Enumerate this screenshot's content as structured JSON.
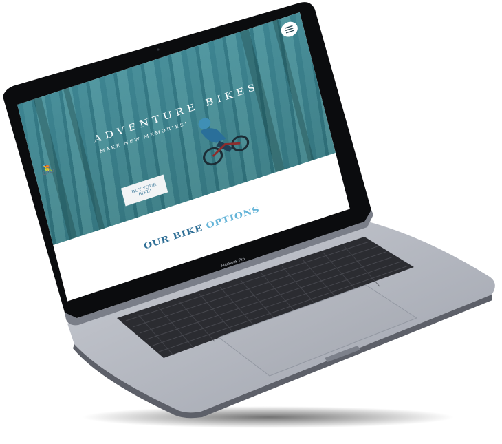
{
  "site": {
    "hero_title": "ADVENTURE BIKES",
    "hero_subtitle": "MAKE NEW MEMORIES!",
    "cta_label": "BUY YOUR BIKE!",
    "section_title_part1": "OUR BIKE",
    "section_title_part2": " OPTIONS"
  },
  "device": {
    "model_label": "MacBook Pro"
  },
  "colors": {
    "accent_dark": "#2f6f96",
    "accent_light": "#64b4d8",
    "hero_overlay": "#3c8ca5"
  }
}
